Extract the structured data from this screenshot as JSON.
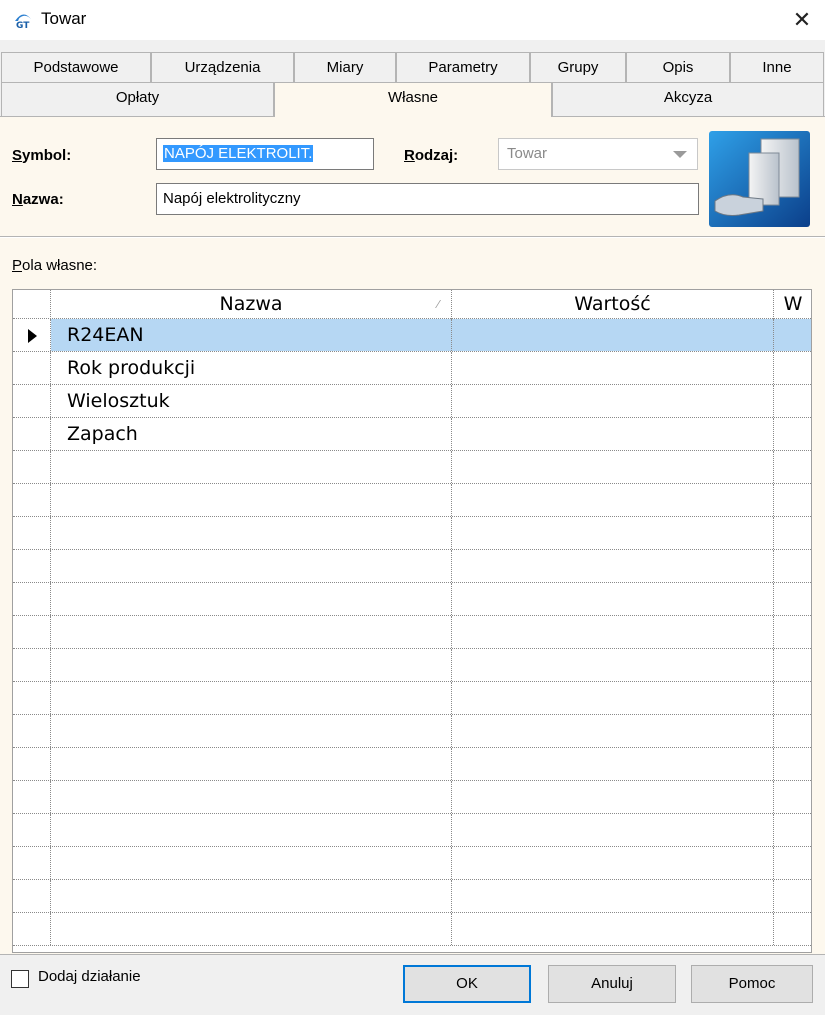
{
  "window": {
    "title": "Towar",
    "close_icon": "close-icon"
  },
  "tabs_row1": [
    "Podstawowe",
    "Urządzenia",
    "Miary",
    "Parametry",
    "Grupy",
    "Opis",
    "Inne"
  ],
  "tabs_row2": [
    "Opłaty",
    "Własne",
    "Akcyza"
  ],
  "active_tab": "Własne",
  "form": {
    "symbol_label": "Symbol:",
    "symbol_value": "NAPÓJ ELEKTROLIT.",
    "nazwa_label": "Nazwa:",
    "nazwa_value": "Napój elektrolityczny",
    "rodzaj_label": "Rodzaj:",
    "rodzaj_value": "Towar"
  },
  "pola_label": "Pola własne:",
  "grid": {
    "columns": [
      "Nazwa",
      "Wartość",
      "W"
    ],
    "rows": [
      {
        "name": "R24EAN",
        "value": "",
        "w": ""
      },
      {
        "name": "Rok produkcji",
        "value": "",
        "w": ""
      },
      {
        "name": "Wielosztuk",
        "value": "",
        "w": ""
      },
      {
        "name": "Zapach",
        "value": "",
        "w": ""
      }
    ],
    "selected_row": 0
  },
  "bottom": {
    "checkbox_label": "Dodaj działanie",
    "ok_label": "OK",
    "cancel_label": "Anuluj",
    "help_label": "Pomoc"
  },
  "colors": {
    "accent": "#0078d7",
    "selected_row": "#b6d7f3",
    "panel": "#fdf8ee",
    "selection": "#3399ff"
  }
}
